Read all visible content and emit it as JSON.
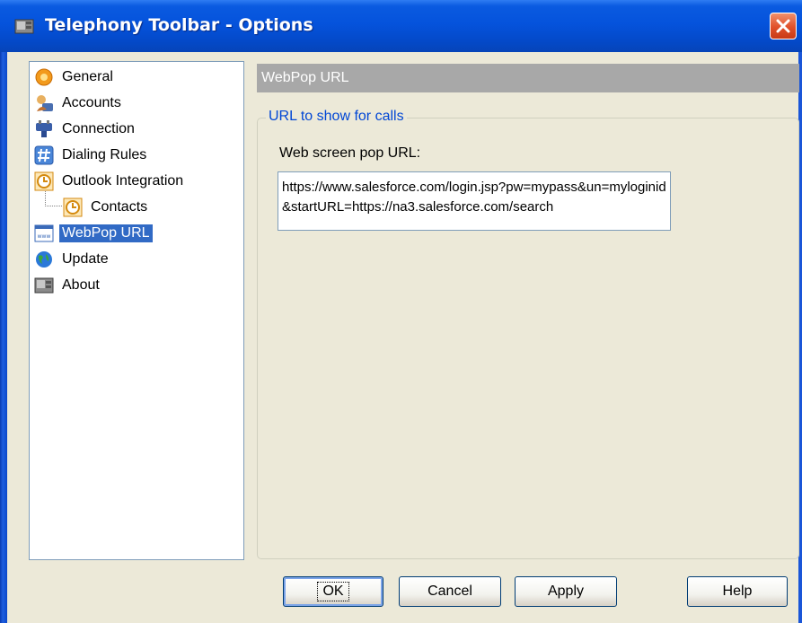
{
  "window": {
    "title": "Telephony Toolbar - Options"
  },
  "tree": {
    "items": [
      {
        "label": "General",
        "icon": "gear-icon"
      },
      {
        "label": "Accounts",
        "icon": "accounts-icon"
      },
      {
        "label": "Connection",
        "icon": "plug-icon"
      },
      {
        "label": "Dialing Rules",
        "icon": "hash-icon"
      },
      {
        "label": "Outlook Integration",
        "icon": "clock-icon"
      },
      {
        "label": "Contacts",
        "icon": "clock-icon"
      },
      {
        "label": "WebPop URL",
        "icon": "www-icon"
      },
      {
        "label": "Update",
        "icon": "globe-icon"
      },
      {
        "label": "About",
        "icon": "about-icon"
      }
    ],
    "selected": "WebPop URL"
  },
  "panel": {
    "header": "WebPop URL",
    "group_title": "URL to show for calls",
    "field_label": "Web screen pop URL:",
    "url_value": "https://www.salesforce.com/login.jsp?pw=mypass&un=myloginid&startURL=https://na3.salesforce.com/search"
  },
  "buttons": {
    "ok": "OK",
    "cancel": "Cancel",
    "apply": "Apply",
    "help": "Help"
  },
  "colors": {
    "titlebar": "#0553dc",
    "selection": "#316ac5",
    "header_bg": "#a8a8a8",
    "group_title": "#0046d5"
  }
}
